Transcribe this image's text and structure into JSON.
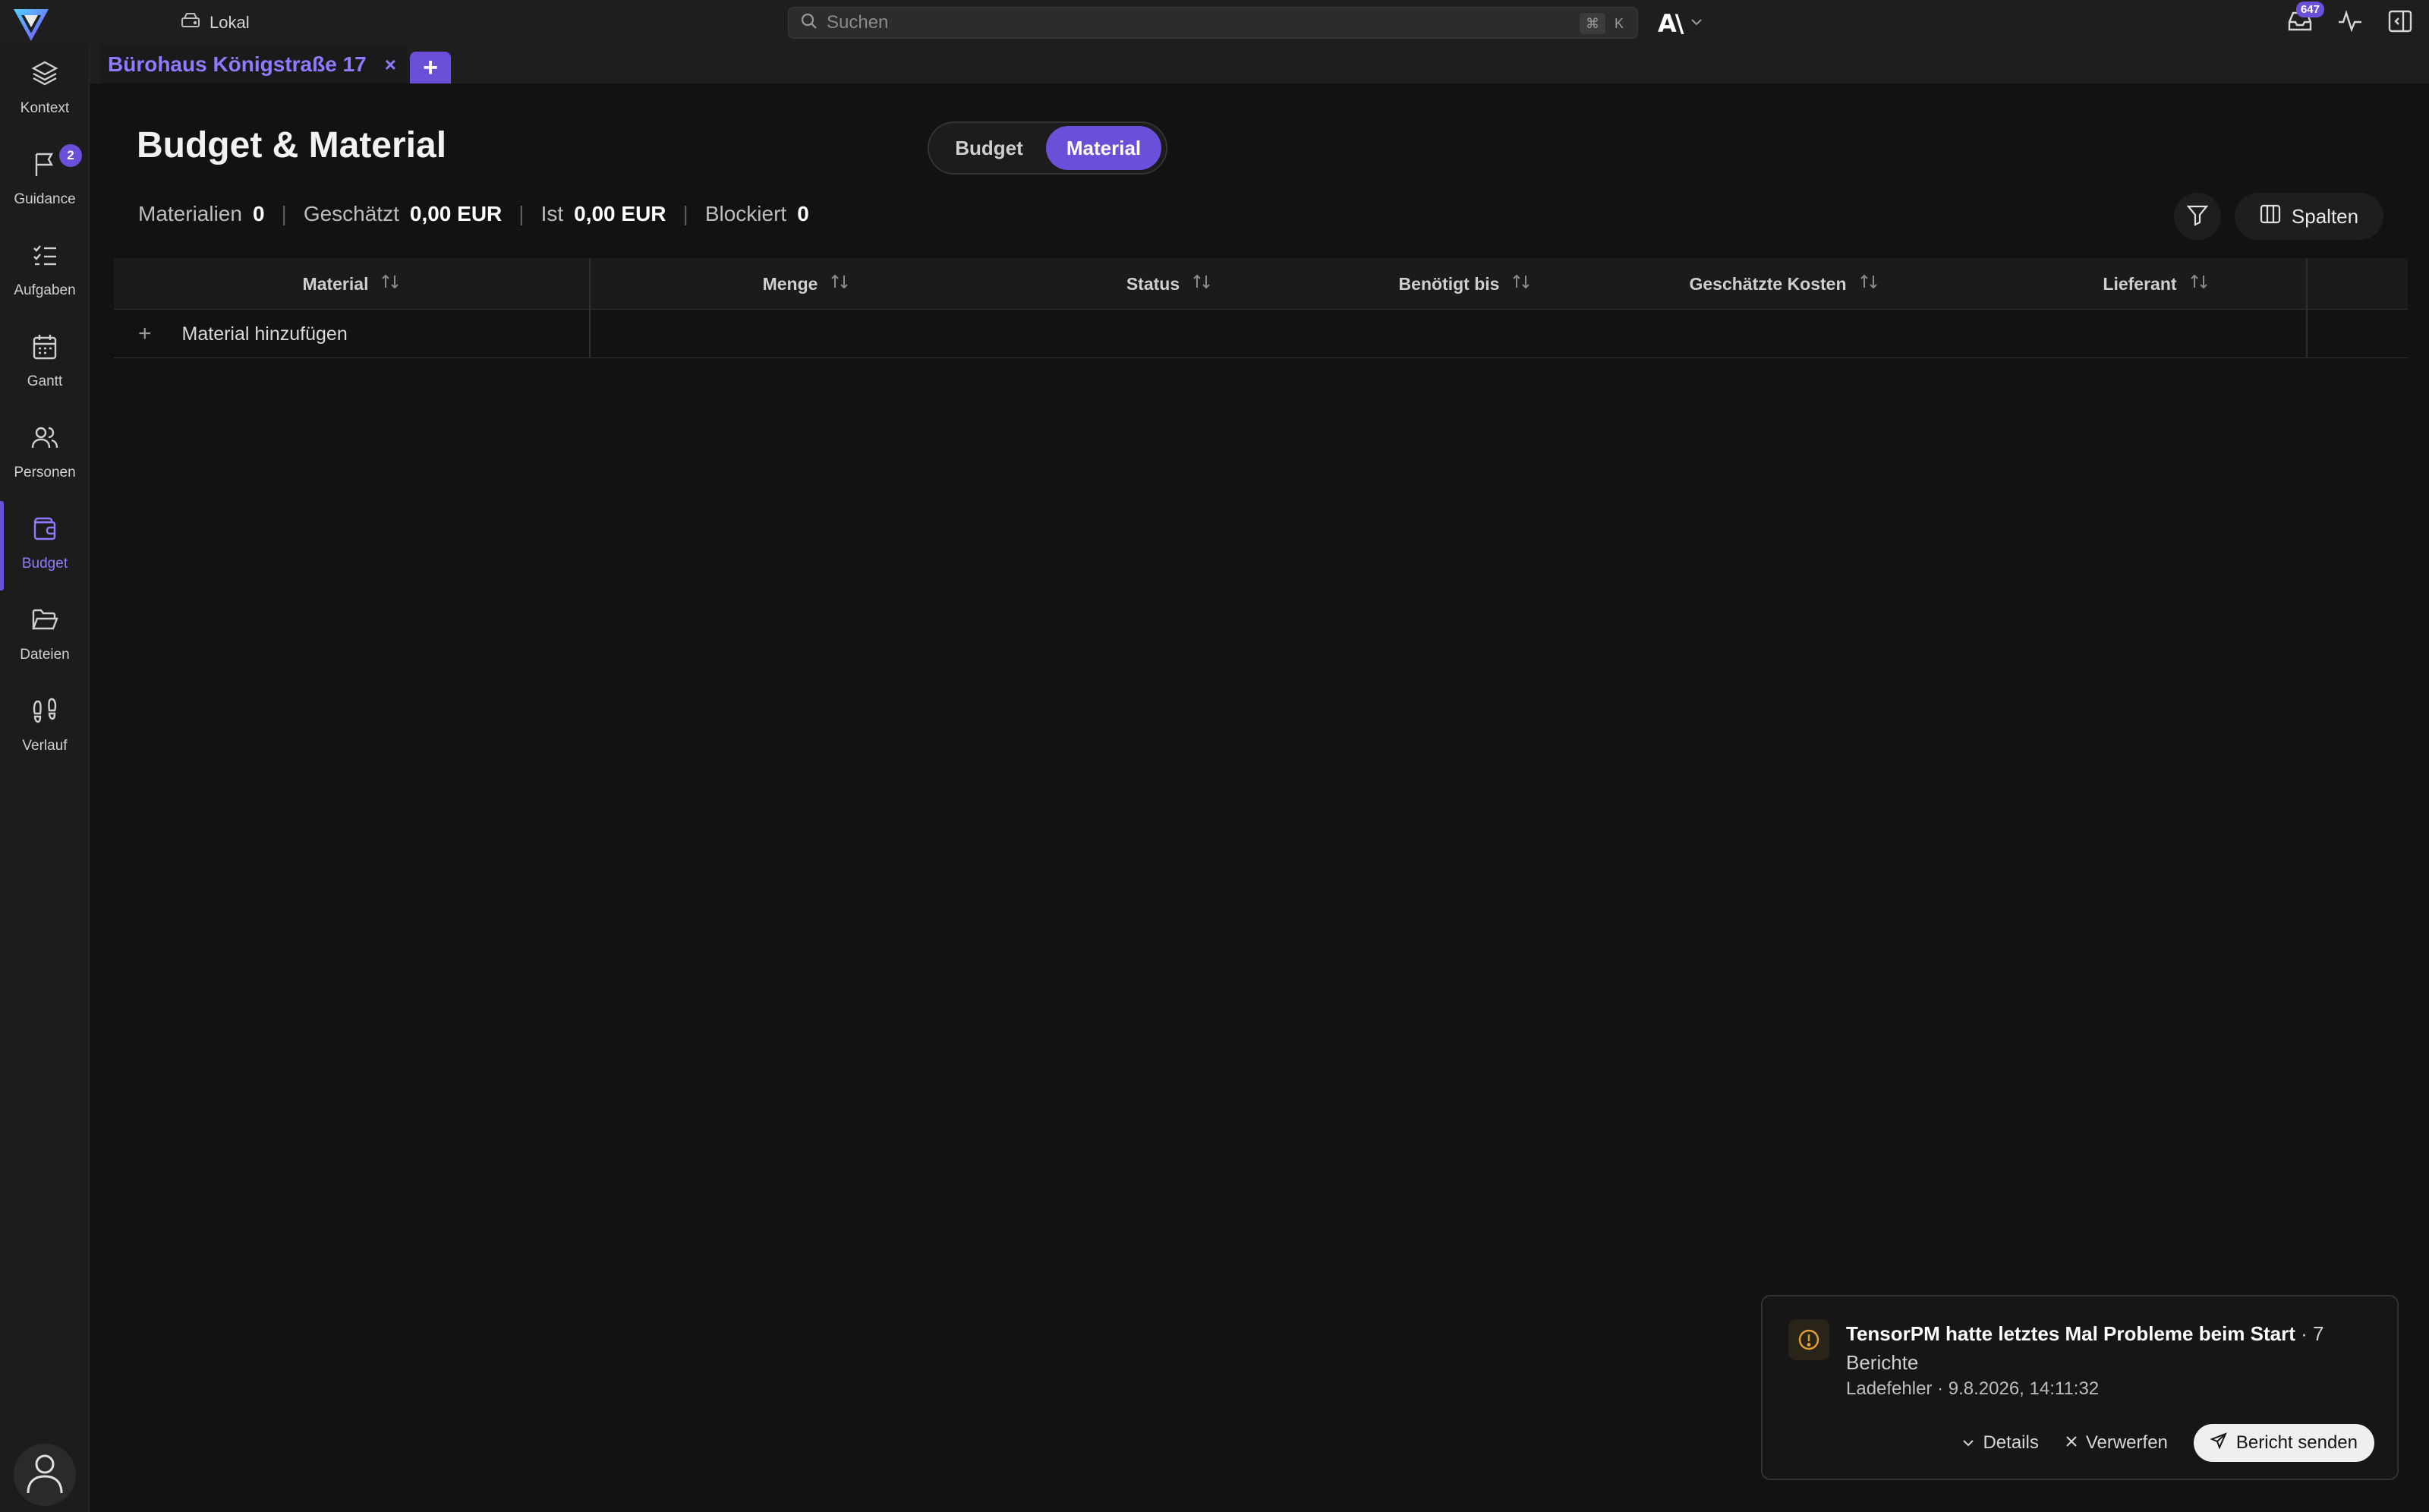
{
  "workspace": {
    "label": "Lokal",
    "icon": "hard-drive-icon"
  },
  "search": {
    "placeholder": "Suchen",
    "shortcut_mod": "⌘",
    "shortcut_key": "K"
  },
  "topbar": {
    "inbox_count": "647",
    "brand_mark": "A\\"
  },
  "sidebar": {
    "items": [
      {
        "label": "Kontext",
        "icon": "layers-icon"
      },
      {
        "label": "Guidance",
        "icon": "flag-icon",
        "badge": "2"
      },
      {
        "label": "Aufgaben",
        "icon": "list-checks-icon"
      },
      {
        "label": "Gantt",
        "icon": "calendar-icon"
      },
      {
        "label": "Personen",
        "icon": "users-icon"
      },
      {
        "label": "Budget",
        "icon": "wallet-icon",
        "active": true
      },
      {
        "label": "Dateien",
        "icon": "folder-icon"
      },
      {
        "label": "Verlauf",
        "icon": "footprints-icon"
      }
    ]
  },
  "tabs": [
    {
      "label": "Bürohaus Königstraße 17",
      "close": "×"
    }
  ],
  "tab_add": "+",
  "page": {
    "title": "Budget & Material",
    "segments": {
      "budget": "Budget",
      "material": "Material"
    },
    "stats": {
      "materialien_label": "Materialien",
      "materialien_value": "0",
      "geschaetzt_label": "Geschätzt",
      "geschaetzt_value": "0,00 EUR",
      "ist_label": "Ist",
      "ist_value": "0,00 EUR",
      "blockiert_label": "Blockiert",
      "blockiert_value": "0",
      "separator": "|"
    },
    "columns_button": "Spalten"
  },
  "table": {
    "headers": [
      "Material",
      "Menge",
      "Status",
      "Benötigt bis",
      "Geschätzte Kosten",
      "Lieferant"
    ],
    "add_row_label": "Material hinzufügen",
    "add_row_plus": "+"
  },
  "toast": {
    "title": "TensorPM hatte letztes Mal Probleme beim Start",
    "title_suffix": " · 7 Berichte",
    "subtitle": "Ladefehler · 9.8.2026, 14:11:32",
    "details": "Details",
    "dismiss": "Verwerfen",
    "send": "Bericht senden"
  },
  "colors": {
    "accent": "#6b4fd8",
    "accent_text": "#8f7bff",
    "warning": "#e0a030",
    "background": "#121212"
  }
}
